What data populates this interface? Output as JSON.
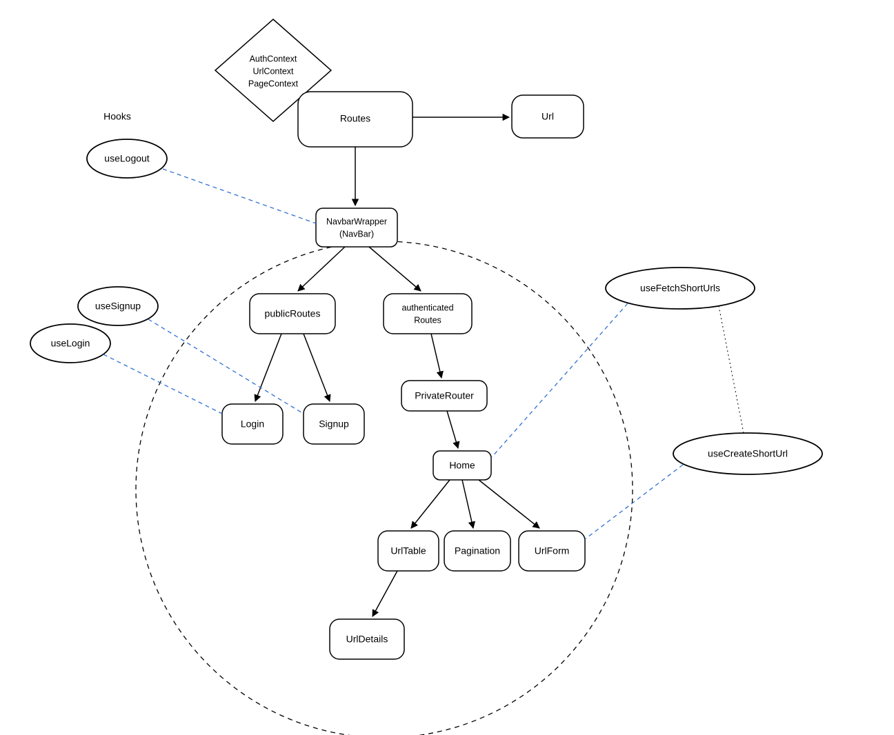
{
  "hooks_heading": "Hooks",
  "context": {
    "line1": "AuthContext",
    "line2": "UrlContext",
    "line3": "PageContext"
  },
  "nodes": {
    "routes": "Routes",
    "url": "Url",
    "navbar_wrapper_line1": "NavbarWrapper",
    "navbar_wrapper_line2": "(NavBar)",
    "public_routes": "publicRoutes",
    "authenticated_routes_line1": "authenticated",
    "authenticated_routes_line2": "Routes",
    "private_router": "PrivateRouter",
    "login": "Login",
    "signup": "Signup",
    "home": "Home",
    "url_table": "UrlTable",
    "pagination": "Pagination",
    "url_form": "UrlForm",
    "url_details": "UrlDetails"
  },
  "hooks": {
    "use_logout": "useLogout",
    "use_signup": "useSignup",
    "use_login": "useLogin",
    "use_fetch_short_urls": "useFetchShortUrls",
    "use_create_short_url": "useCreateShortUrl"
  }
}
